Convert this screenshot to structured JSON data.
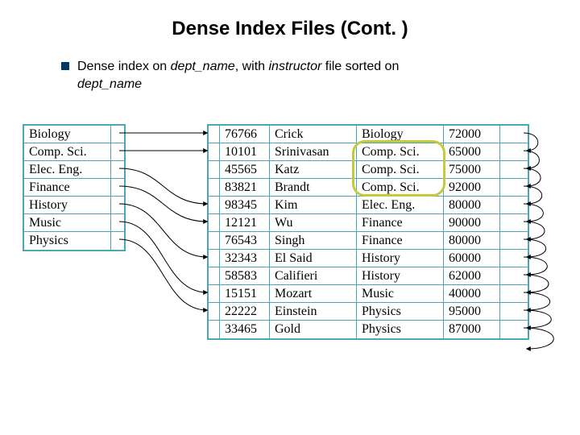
{
  "title": "Dense Index Files (Cont. )",
  "bullet": {
    "before": "Dense index on ",
    "field1": "dept_name",
    "mid": ", with ",
    "field2": "instructor",
    "after1": " file sorted on ",
    "field3": "dept_name"
  },
  "index_rows": [
    "Biology",
    "Comp. Sci.",
    "Elec. Eng.",
    "Finance",
    "History",
    "Music",
    "Physics"
  ],
  "data_rows": [
    {
      "id": "76766",
      "name": "Crick",
      "dept": "Biology",
      "salary": "72000"
    },
    {
      "id": "10101",
      "name": "Srinivasan",
      "dept": "Comp. Sci.",
      "salary": "65000"
    },
    {
      "id": "45565",
      "name": "Katz",
      "dept": "Comp. Sci.",
      "salary": "75000"
    },
    {
      "id": "83821",
      "name": "Brandt",
      "dept": "Comp. Sci.",
      "salary": "92000"
    },
    {
      "id": "98345",
      "name": "Kim",
      "dept": "Elec. Eng.",
      "salary": "80000"
    },
    {
      "id": "12121",
      "name": "Wu",
      "dept": "Finance",
      "salary": "90000"
    },
    {
      "id": "76543",
      "name": "Singh",
      "dept": "Finance",
      "salary": "80000"
    },
    {
      "id": "32343",
      "name": "El Said",
      "dept": "History",
      "salary": "60000"
    },
    {
      "id": "58583",
      "name": "Califieri",
      "dept": "History",
      "salary": "62000"
    },
    {
      "id": "15151",
      "name": "Mozart",
      "dept": "Music",
      "salary": "40000"
    },
    {
      "id": "22222",
      "name": "Einstein",
      "dept": "Physics",
      "salary": "95000"
    },
    {
      "id": "33465",
      "name": "Gold",
      "dept": "Physics",
      "salary": "87000"
    }
  ],
  "index_to_data": [
    0,
    1,
    4,
    5,
    7,
    9,
    10
  ],
  "next_chain": [
    1,
    2,
    3,
    4,
    5,
    6,
    7,
    8,
    9,
    10,
    11,
    12
  ],
  "highlight": {
    "dept": "Comp. Sci.",
    "from_row": 1,
    "to_row": 3
  }
}
